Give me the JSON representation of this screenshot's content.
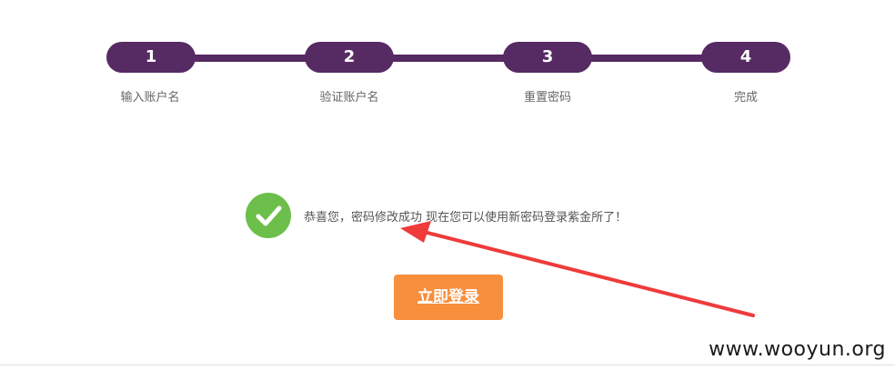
{
  "steps": [
    {
      "number": "1",
      "label": "输入账户名"
    },
    {
      "number": "2",
      "label": "验证账户名"
    },
    {
      "number": "3",
      "label": "重置密码"
    },
    {
      "number": "4",
      "label": "完成"
    }
  ],
  "message": {
    "text": "恭喜您，密码修改成功 现在您可以使用新密码登录紫金所了！",
    "icon": "checkmark-circle-icon"
  },
  "login_button": {
    "label": "立即登录"
  },
  "watermark": "www.wooyun.org",
  "colors": {
    "step": "#562a63",
    "success": "#6bbf4a",
    "button": "#f78f3d",
    "arrow": "#ee3b3b"
  }
}
